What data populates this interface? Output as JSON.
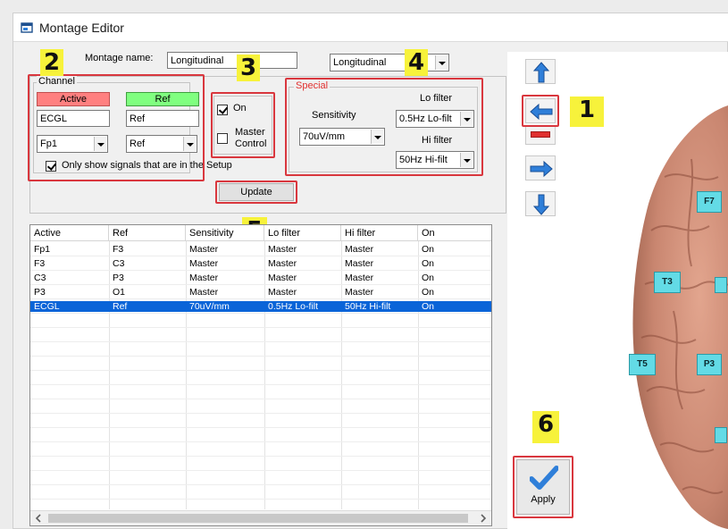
{
  "window": {
    "title": "Montage Editor"
  },
  "montage": {
    "name_label": "Montage name:",
    "name_value": "Longitudinal",
    "type_value": "Longitudinal"
  },
  "channel": {
    "group_label": "Channel",
    "active_header": "Active",
    "ref_header": "Ref",
    "active_value": "ECGL",
    "ref_value": "Ref",
    "active_select": "Fp1",
    "ref_select": "Ref",
    "only_show_label": "Only show signals that are in the Setup",
    "only_show_checked": true
  },
  "options": {
    "on_label": "On",
    "on_checked": true,
    "master_control_label_1": "Master",
    "master_control_label_2": "Control",
    "master_control_checked": false
  },
  "special": {
    "group_label": "Special",
    "sensitivity_label": "Sensitivity",
    "sensitivity_value": "70uV/mm",
    "lo_filter_label": "Lo filter",
    "lo_filter_value": "0.5Hz Lo-filt",
    "hi_filter_label": "Hi filter",
    "hi_filter_value": "50Hz Hi-filt"
  },
  "update_button": "Update",
  "table": {
    "columns": [
      "Active",
      "Ref",
      "Sensitivity",
      "Lo filter",
      "Hi filter",
      "On"
    ],
    "rows": [
      [
        "Fp1",
        "F3",
        "Master",
        "Master",
        "Master",
        "On"
      ],
      [
        "F3",
        "C3",
        "Master",
        "Master",
        "Master",
        "On"
      ],
      [
        "C3",
        "P3",
        "Master",
        "Master",
        "Master",
        "On"
      ],
      [
        "P3",
        "O1",
        "Master",
        "Master",
        "Master",
        "On"
      ],
      [
        "ECGL",
        "Ref",
        "70uV/mm",
        "0.5Hz Lo-filt",
        "50Hz Hi-filt",
        "On"
      ]
    ],
    "selected_row": 4
  },
  "electrodes": [
    "F7",
    "T3",
    "T5",
    "P3"
  ],
  "apply_button": "Apply",
  "callouts": [
    "1",
    "2",
    "3",
    "4",
    "5",
    "6"
  ],
  "colors": {
    "active_header": "#ff8080",
    "ref_header": "#80ff80",
    "highlight_box": "#d9373e",
    "callout_badge": "#f7f23b",
    "selected_row": "#0a64d8",
    "electrode": "#63dbe6",
    "arrow_blue": "#2f7fd9",
    "remove_red": "#e0302f"
  },
  "icons": {
    "title": "montage-editor-icon",
    "move_up": "arrow-up-icon",
    "move_left": "arrow-left-icon",
    "remove": "minus-icon",
    "move_right": "arrow-right-icon",
    "move_down": "arrow-down-icon",
    "apply": "checkmark-icon",
    "brain": "brain-illustration"
  }
}
